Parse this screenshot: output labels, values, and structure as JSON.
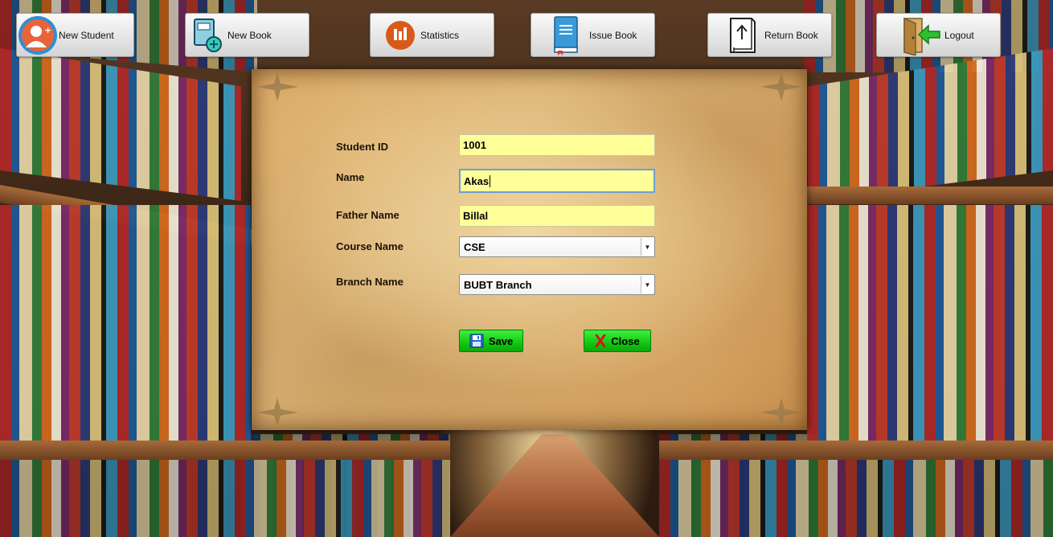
{
  "toolbar": {
    "new_student": "New Student",
    "new_book": "New Book",
    "statistics": "Statistics",
    "issue_book": "Issue Book",
    "return_book": "Return Book",
    "logout": "Logout"
  },
  "form": {
    "student_id": {
      "label": "Student ID",
      "value": "1001"
    },
    "name": {
      "label": "Name",
      "value": "Akas"
    },
    "father_name": {
      "label": "Father Name",
      "value": "Billal"
    },
    "course_name": {
      "label": "Course Name",
      "value": "CSE"
    },
    "branch_name": {
      "label": "Branch Name",
      "value": "BUBT Branch"
    }
  },
  "actions": {
    "save": "Save",
    "close": "Close"
  },
  "icons": {
    "new_student": "add-user-icon",
    "new_book": "add-book-icon",
    "statistics": "bar-chart-icon",
    "issue_book": "book-icon",
    "return_book": "return-book-icon",
    "logout": "logout-door-icon",
    "save": "floppy-disk-icon",
    "close": "red-x-icon"
  },
  "colors": {
    "input_bg": "#ffff99",
    "button_green": "#12c812",
    "focus_border": "#6e9fd0"
  }
}
